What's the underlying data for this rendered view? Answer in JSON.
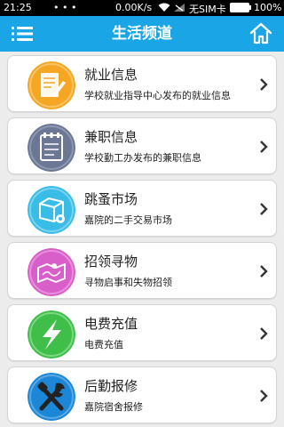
{
  "status_bar": {
    "time": "21:25",
    "dots": "• • •",
    "speed": "0.00K/s",
    "sim": "无SIM卡",
    "battery": "100%"
  },
  "header": {
    "title": "生活频道",
    "menu_icon": "menu-icon",
    "home_icon": "home-icon",
    "bg_color": "#1aa6e6"
  },
  "items": [
    {
      "title": "就业信息",
      "subtitle": "学校就业指导中心发布的就业信息",
      "icon": "document-pen-icon",
      "color": "#f5a623"
    },
    {
      "title": "兼职信息",
      "subtitle": "学校勤工办发布的兼职信息",
      "icon": "notepad-icon",
      "color": "#6b7794"
    },
    {
      "title": "跳蚤市场",
      "subtitle": "嘉院的二手交易市场",
      "icon": "box-icon",
      "color": "#39bde6"
    },
    {
      "title": "招领寻物",
      "subtitle": "寻物启事和失物招领",
      "icon": "map-icon",
      "color": "#d85fc9"
    },
    {
      "title": "电费充值",
      "subtitle": "电费充值",
      "icon": "lightning-icon",
      "color": "#3fbf4a"
    },
    {
      "title": "后勤报修",
      "subtitle": "嘉院宿舍报修",
      "icon": "tools-icon",
      "color": "#1b87d6"
    }
  ]
}
